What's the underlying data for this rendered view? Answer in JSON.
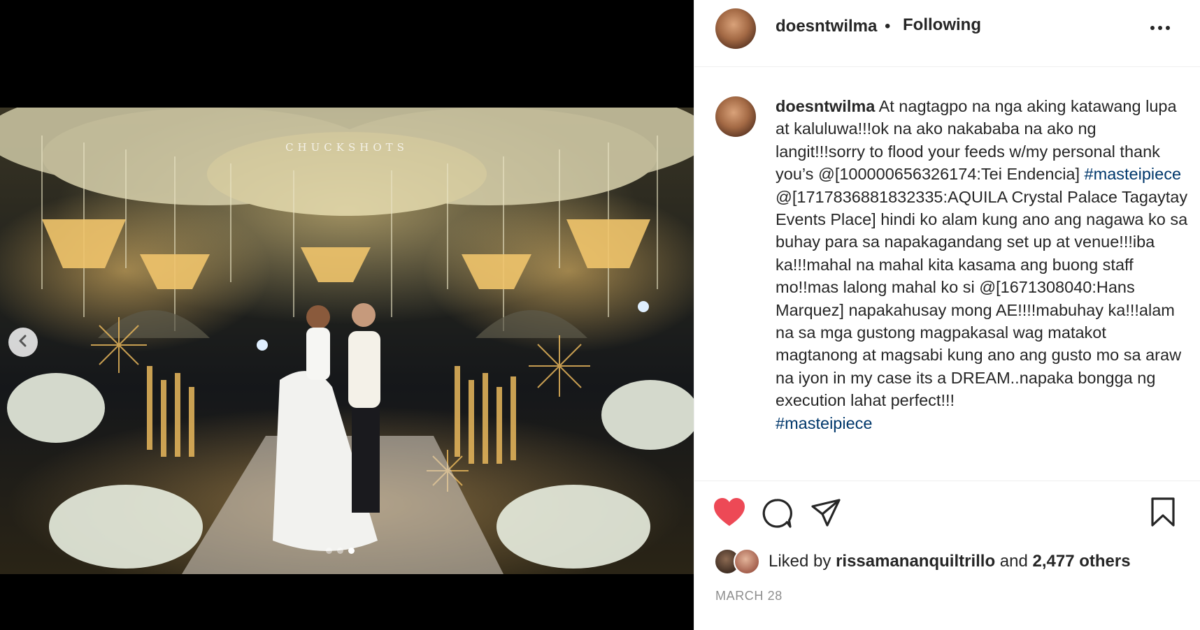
{
  "media": {
    "watermark": "CHUCKSHOTS",
    "carousel": {
      "count": 3,
      "active_index": 2
    }
  },
  "header": {
    "username": "doesntwilma",
    "separator": "•",
    "follow_state": "Following"
  },
  "caption": {
    "username": "doesntwilma",
    "parts": [
      {
        "type": "text",
        "text": " At nagtagpo na nga aking katawang lupa at kaluluwa!!!ok na ako nakababa na ako ng langit!!!sorry to flood your feeds w/my personal thank you’s @[100000656326174:Tei Endencia] "
      },
      {
        "type": "tag",
        "text": "#masteipiece"
      },
      {
        "type": "text",
        "text": " @[1717836881832335:AQUILA Crystal Palace Tagaytay Events Place] hindi ko alam kung ano ang nagawa ko sa buhay para sa napakagandang set up at venue!!!iba ka!!!mahal na mahal kita kasama ang buong staff mo!!mas lalong mahal ko si @[1671308040:Hans Marquez] napakahusay mong AE!!!!mabuhay ka!!!alam na sa mga gustong magpakasal wag matakot magtanong at magsabi kung ano ang gusto mo sa araw na iyon in my case its a DREAM..napaka bongga ng execution lahat perfect!!!\n"
      },
      {
        "type": "tag",
        "text": "#masteipiece"
      }
    ]
  },
  "actions": {
    "liked": true,
    "like_color": "#ed4956",
    "icons": [
      "heart-icon",
      "comment-icon",
      "share-icon",
      "bookmark-icon"
    ]
  },
  "likes": {
    "prefix": "Liked by",
    "user": "rissamananquiltrillo",
    "connector": "and",
    "others": "2,477 others"
  },
  "date": "MARCH 28"
}
